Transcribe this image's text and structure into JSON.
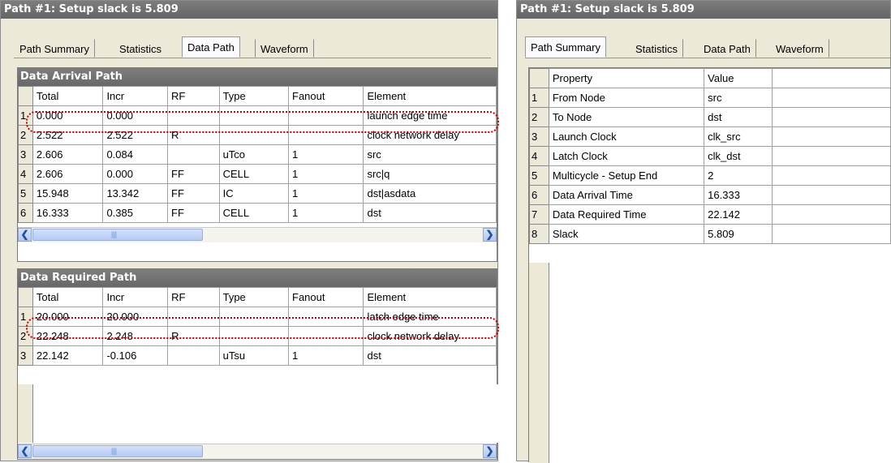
{
  "left": {
    "title": "Path #1: Setup slack is 5.809",
    "tabs": [
      "Path Summary",
      "Statistics",
      "Data Path",
      "Waveform"
    ],
    "active_tab": "Data Path",
    "arrival": {
      "title": "Data Arrival Path",
      "columns": [
        "Total",
        "Incr",
        "RF",
        "Type",
        "Fanout",
        "Element"
      ],
      "rows": [
        {
          "num": "1",
          "cells": [
            "0.000",
            "0.000",
            "",
            "",
            "",
            "launch edge time"
          ]
        },
        {
          "num": "2",
          "cells": [
            "2.522",
            "2.522",
            "R",
            "",
            "",
            "clock network delay"
          ]
        },
        {
          "num": "3",
          "cells": [
            "2.606",
            "0.084",
            "",
            "uTco",
            "1",
            "src"
          ]
        },
        {
          "num": "4",
          "cells": [
            "2.606",
            "0.000",
            "FF",
            "CELL",
            "1",
            "src|q"
          ]
        },
        {
          "num": "5",
          "cells": [
            "15.948",
            "13.342",
            "FF",
            "IC",
            "1",
            "dst|asdata"
          ]
        },
        {
          "num": "6",
          "cells": [
            "16.333",
            "0.385",
            "FF",
            "CELL",
            "1",
            "dst"
          ]
        }
      ]
    },
    "required": {
      "title": "Data Required Path",
      "columns": [
        "Total",
        "Incr",
        "RF",
        "Type",
        "Fanout",
        "Element"
      ],
      "rows": [
        {
          "num": "1",
          "cells": [
            "20.000",
            "20.000",
            "",
            "",
            "",
            "latch edge time"
          ]
        },
        {
          "num": "2",
          "cells": [
            "22.248",
            "2.248",
            "R",
            "",
            "",
            "clock network delay"
          ]
        },
        {
          "num": "3",
          "cells": [
            "22.142",
            "-0.106",
            "",
            "uTsu",
            "1",
            "dst"
          ]
        }
      ]
    }
  },
  "right": {
    "title": "Path #1: Setup slack is 5.809",
    "tabs": [
      "Path Summary",
      "Statistics",
      "Data Path",
      "Waveform"
    ],
    "active_tab": "Path Summary",
    "columns": [
      "Property",
      "Value"
    ],
    "rows": [
      {
        "num": "1",
        "property": "From Node",
        "value": "src"
      },
      {
        "num": "2",
        "property": "To Node",
        "value": "dst"
      },
      {
        "num": "3",
        "property": "Launch Clock",
        "value": "clk_src"
      },
      {
        "num": "4",
        "property": "Latch Clock",
        "value": "clk_dst"
      },
      {
        "num": "5",
        "property": "Multicycle - Setup End",
        "value": "2"
      },
      {
        "num": "6",
        "property": "Data Arrival Time",
        "value": "16.333"
      },
      {
        "num": "7",
        "property": "Data Required Time",
        "value": "22.142"
      },
      {
        "num": "8",
        "property": "Slack",
        "value": "5.809"
      }
    ]
  },
  "icons": {
    "scroll_left": "scroll-left-arrow-icon",
    "scroll_right": "scroll-right-arrow-icon",
    "grip": "scroll-thumb-grip-icon"
  },
  "colors": {
    "titlebar": "#6e6e6e",
    "panel_bg": "#ece9d8",
    "highlight": "#c00000",
    "scroll_button": "#c4d4f5"
  }
}
